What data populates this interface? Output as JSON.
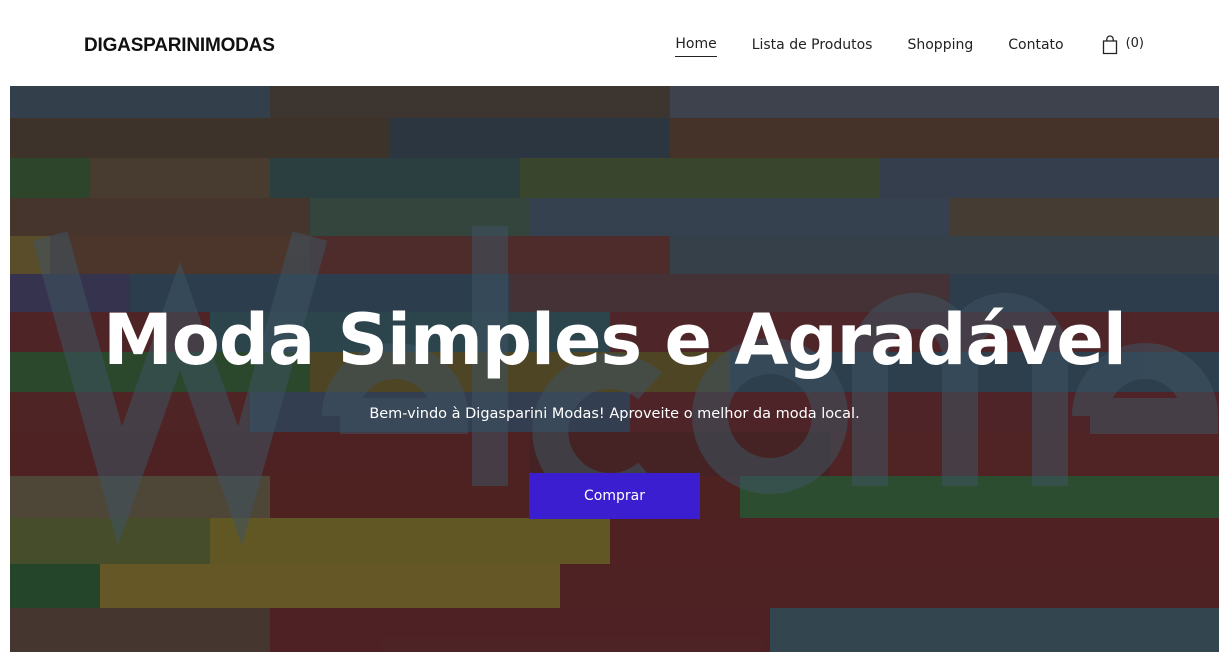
{
  "header": {
    "brand": "DIGASPARINIMODAS",
    "nav": {
      "home": "Home",
      "products": "Lista de Produtos",
      "shopping": "Shopping",
      "contact": "Contato"
    },
    "cart": {
      "icon": "shopping-bag-icon",
      "count": "(0)"
    }
  },
  "hero": {
    "title": "Moda Simples e Agradável",
    "subtitle": "Bem-vindo à Digasparini Modas! Aproveite o melhor da moda local.",
    "button_label": "Comprar",
    "background_image": "colorful painted wooden wall with large 'Welcome' lettering"
  },
  "colors": {
    "accent": "#3a1ed0",
    "text": "#222222",
    "brand_text": "#111111"
  }
}
